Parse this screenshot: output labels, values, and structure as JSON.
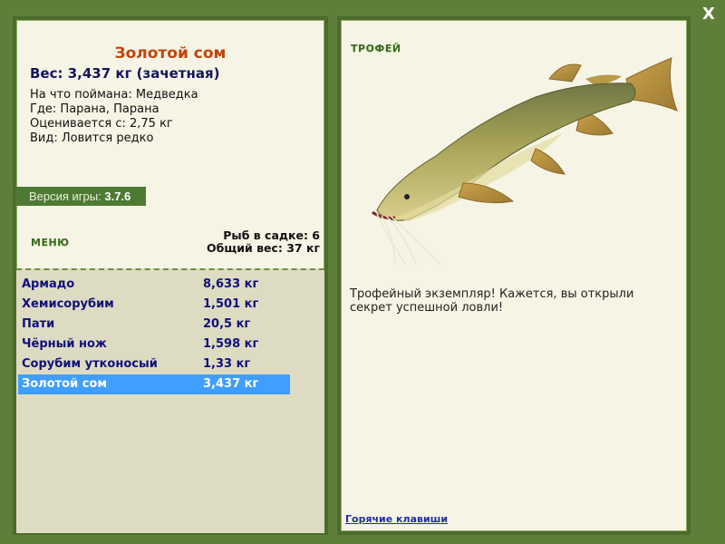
{
  "window": {
    "close_label": "X"
  },
  "selected_fish": {
    "name": "Золотой сом",
    "weight_line": "Вес: 3,437 кг (зачетная)",
    "bait_line": "На что поймана: Медведка",
    "location_line": "Где: Парана, Парана",
    "valued_line": "Оценивается с: 2,75 кг",
    "kind_line": "Вид: Ловится редко"
  },
  "version": {
    "label": "Версия игры:",
    "value": "3.7.6"
  },
  "menu": {
    "label": "МЕНЮ"
  },
  "keepnet": {
    "count_line": "Рыб в садке: 6",
    "total_line": "Общий вес: 37 кг"
  },
  "catch_list": [
    {
      "name": "Армадо",
      "weight": "8,633 кг",
      "selected": false
    },
    {
      "name": "Хемисорубим",
      "weight": "1,501 кг",
      "selected": false
    },
    {
      "name": "Пати",
      "weight": "20,5 кг",
      "selected": false
    },
    {
      "name": "Чёрный нож",
      "weight": "1,598 кг",
      "selected": false
    },
    {
      "name": "Сорубим утконосый",
      "weight": "1,33 кг",
      "selected": false
    },
    {
      "name": "Золотой сом",
      "weight": "3,437 кг",
      "selected": true
    }
  ],
  "trophy": {
    "label": "ТРОФЕЙ",
    "message": "Трофейный экземпляр! Кажется, вы открыли секрет успешной ловли!"
  },
  "hotkeys": {
    "label": "Горячие клавиши"
  },
  "colors": {
    "background": "#5e7f3a",
    "panel": "#f6f4e4",
    "panel_border": "#4c6b2c",
    "selection": "#3f9eff",
    "fish_title": "#c0450a",
    "list_text": "#10107a"
  }
}
